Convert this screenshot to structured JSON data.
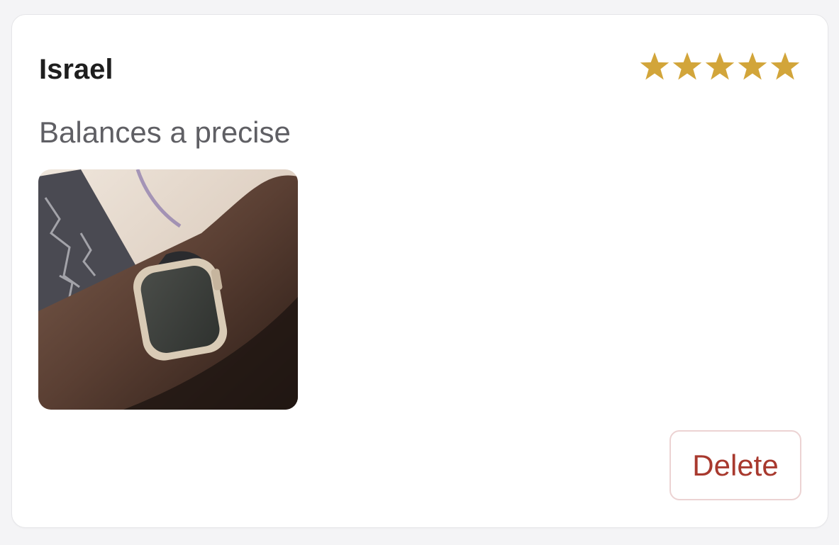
{
  "review": {
    "reviewer_name": "Israel",
    "rating": 5,
    "rating_max": 5,
    "text": "Balances a precise",
    "photo_icon": "wrist-watch-photo",
    "delete_label": "Delete"
  },
  "colors": {
    "star": "#d2a53a",
    "delete_text": "#a8392e",
    "delete_border": "#ecd3d3",
    "name_text": "#1e1e1e",
    "body_text": "#5f5f64"
  }
}
